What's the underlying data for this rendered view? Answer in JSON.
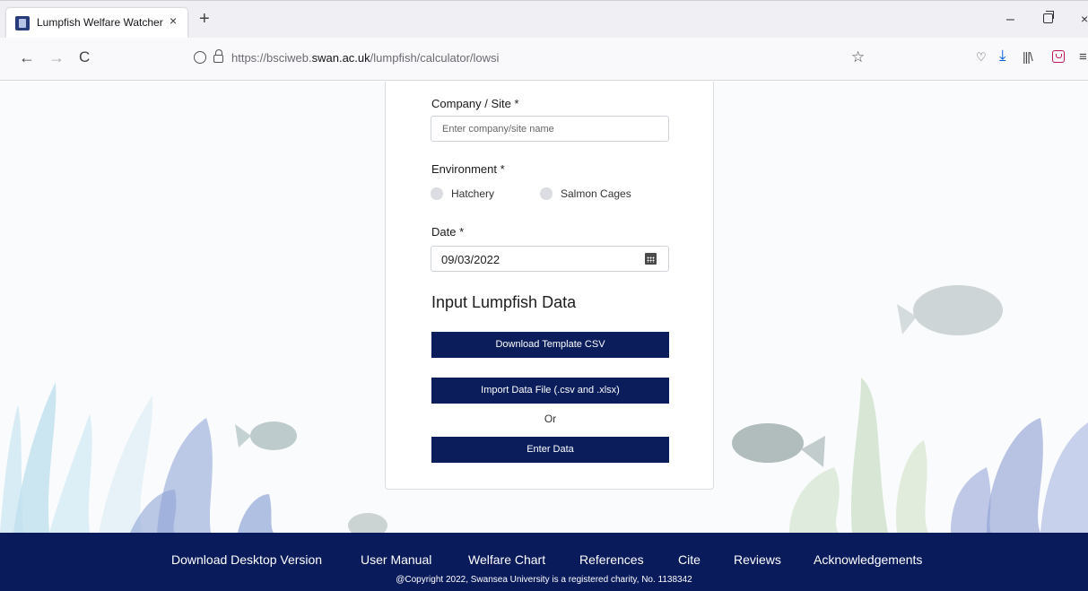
{
  "browser": {
    "tab_title": "Lumpfish Welfare Watcher",
    "tab_close": "×",
    "new_tab": "+",
    "url_prefix": "https://bsciweb.",
    "url_domain": "swan.ac.uk",
    "url_path": "/lumpfish/calculator/lowsi",
    "nav_back": "←",
    "nav_forward": "→",
    "nav_reload": "C",
    "window_minimize": "–",
    "window_close": "×"
  },
  "form": {
    "company_label": "Company / Site *",
    "company_placeholder": "Enter company/site name",
    "environment_label": "Environment *",
    "environment_options": [
      "Hatchery",
      "Salmon Cages"
    ],
    "date_label": "Date *",
    "date_value": "09/03/2022",
    "section_title": "Input Lumpfish Data",
    "download_button": "Download Template CSV",
    "import_button": "Import Data File (.csv and .xlsx)",
    "or_text": "Or",
    "enter_button": "Enter Data"
  },
  "footer": {
    "links": [
      "Download Desktop Version",
      "User Manual",
      "Welfare Chart",
      "References",
      "Cite",
      "Reviews",
      "Acknowledgements"
    ],
    "copyright": "@Copyright 2022, Swansea University is a registered charity, No. 1138342"
  },
  "colors": {
    "primary_button": "#0b1e5b",
    "footer_bg": "#0a1b5c",
    "page_bg": "#fafbfc"
  }
}
